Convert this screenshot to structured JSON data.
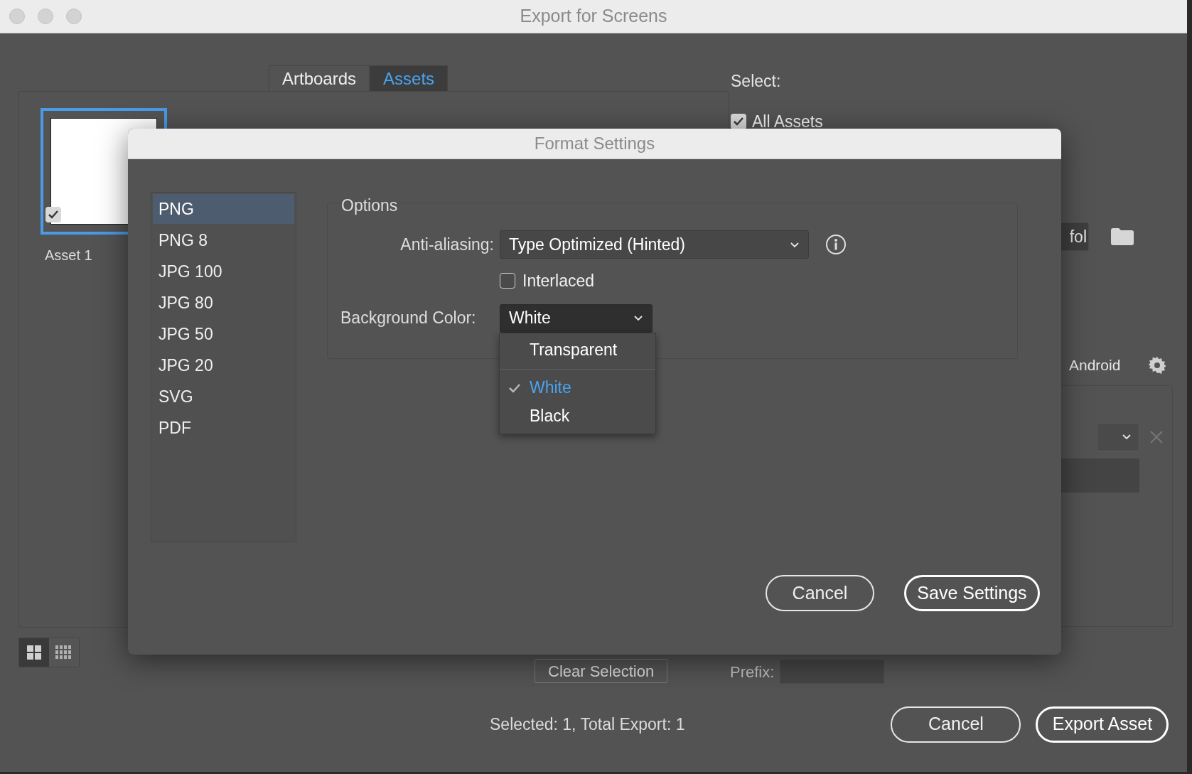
{
  "window": {
    "title": "Export for Screens"
  },
  "tabs": [
    {
      "label": "Artboards",
      "selected": false
    },
    {
      "label": "Assets",
      "selected": true
    }
  ],
  "assets": [
    {
      "name": "Asset 1",
      "checked": true,
      "selected": true
    }
  ],
  "select": {
    "label": "Select:",
    "options": [
      {
        "label": "All Assets",
        "checked": true
      }
    ]
  },
  "folder_field": {
    "value": "fol"
  },
  "platform": "Android",
  "view_toggles": [
    {
      "kind": "grid",
      "selected": true
    },
    {
      "kind": "list",
      "selected": false
    }
  ],
  "clear_selection": "Clear Selection",
  "prefix": {
    "label": "Prefix:"
  },
  "status": "Selected: 1, Total Export: 1",
  "buttons": [
    "Cancel",
    "Export Asset"
  ],
  "format_dialog": {
    "title": "Format Settings",
    "formats": [
      {
        "label": "PNG",
        "selected": true
      },
      {
        "label": "PNG 8",
        "selected": false
      },
      {
        "label": "JPG 100",
        "selected": false
      },
      {
        "label": "JPG 80",
        "selected": false
      },
      {
        "label": "JPG 50",
        "selected": false
      },
      {
        "label": "JPG 20",
        "selected": false
      },
      {
        "label": "SVG",
        "selected": false
      },
      {
        "label": "PDF",
        "selected": false
      }
    ],
    "options_title": "Options",
    "anti_aliasing": {
      "label": "Anti-aliasing:",
      "value": "Type Optimized (Hinted)"
    },
    "interlaced": {
      "label": "Interlaced",
      "checked": false
    },
    "background_color": {
      "label": "Background Color:",
      "value": "White",
      "expanded": true,
      "options": [
        {
          "label": "Transparent",
          "selected": false
        },
        {
          "label": "White",
          "selected": true
        },
        {
          "label": "Black",
          "selected": false
        }
      ]
    },
    "buttons": [
      "Cancel",
      "Save Settings"
    ]
  }
}
